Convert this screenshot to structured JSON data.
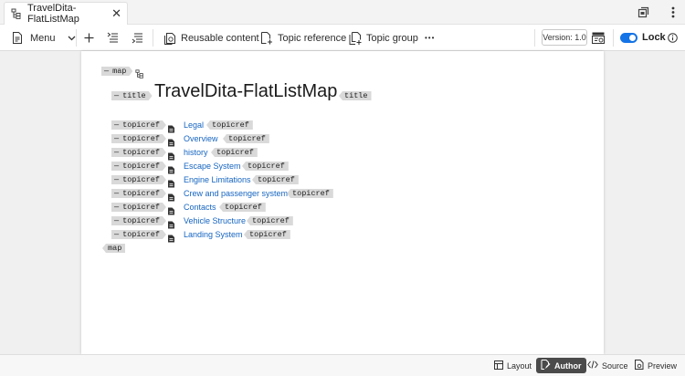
{
  "tab": {
    "title": "TravelDita-FlatListMap",
    "close_glyph": "✕"
  },
  "toolbar": {
    "menu_label": "Menu",
    "reusable_label": "Reusable content",
    "topicref_label": "Topic reference",
    "topicgroup_label": "Topic group",
    "more_glyph": "•••",
    "version_label": "Version: 1.0",
    "lock_label": "Lock",
    "lock_on": true
  },
  "editor": {
    "map_tag": "map",
    "title_tag": "title",
    "title_text": "TravelDita-FlatListMap",
    "topicref_tag": "topicref",
    "dash": "—",
    "topicrefs": [
      {
        "label": "Legal"
      },
      {
        "label": "Overview"
      },
      {
        "label": "history"
      },
      {
        "label": "Escape System"
      },
      {
        "label": "Engine Limitations"
      },
      {
        "label": "Crew and passenger system"
      },
      {
        "label": "Contacts"
      },
      {
        "label": "Vehicle Structure"
      },
      {
        "label": "Landing System"
      }
    ]
  },
  "bottombar": {
    "layout_label": "Layout",
    "author_label": "Author",
    "source_label": "Source",
    "preview_label": "Preview",
    "active_view": "Author"
  },
  "colors": {
    "accent": "#1473e6",
    "link": "#1665c1",
    "tag_bg": "#d9d9d9",
    "active_view_bg": "#4b4b4b"
  }
}
